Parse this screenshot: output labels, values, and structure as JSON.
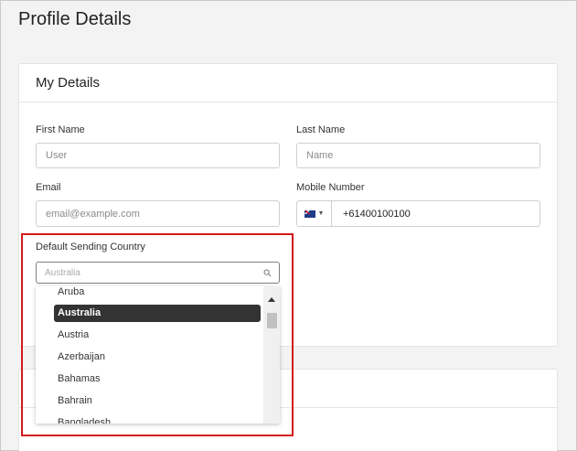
{
  "page": {
    "title": "Profile Details"
  },
  "my_details": {
    "header": "My Details",
    "first_name": {
      "label": "First Name",
      "placeholder": "User"
    },
    "last_name": {
      "label": "Last Name",
      "placeholder": "Name"
    },
    "email": {
      "label": "Email",
      "placeholder": "email@example.com"
    },
    "mobile": {
      "label": "Mobile Number",
      "value": "+61400100100",
      "flag": "australia-flag-icon"
    },
    "country": {
      "label": "Default Sending Country",
      "placeholder": "Australia",
      "options": [
        "Aruba",
        "Australia",
        "Austria",
        "Azerbaijan",
        "Bahamas",
        "Bahrain",
        "Bangladesh"
      ],
      "selected": "Australia"
    }
  },
  "colors": {
    "highlight_border": "#d3191c",
    "selected_option_bg": "#333333"
  }
}
